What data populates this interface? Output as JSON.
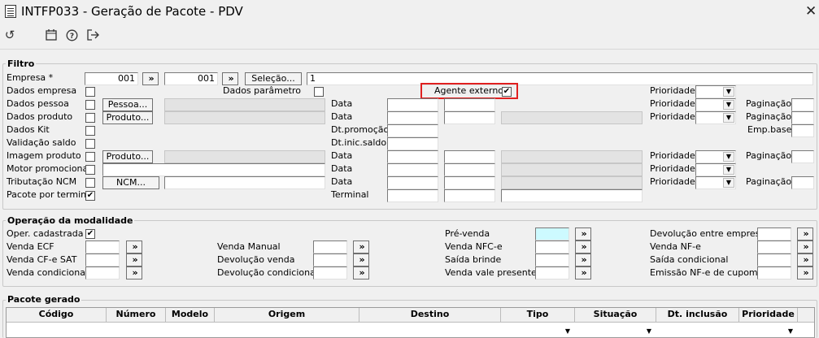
{
  "window": {
    "title": "INTFP033 - Geração de Pacote - PDV",
    "close": "✕"
  },
  "toolbar": {
    "refresh_icon": "↺",
    "calendar_icon": "calendar",
    "help_icon": "?",
    "exit_icon": "exit"
  },
  "filtro": {
    "title": "Filtro",
    "empresa_label": "Empresa *",
    "empresa_from": "001",
    "empresa_to": "001",
    "arrow": "»",
    "selecao_label": "Seleção...",
    "selecao_value": "1",
    "dados_empresa": "Dados empresa",
    "dados_parametro": "Dados parâmetro",
    "agente_externo": "Agente externo",
    "agente_checked": "✔",
    "dados_pessoa": "Dados pessoa",
    "pessoa_btn": "Pessoa...",
    "dados_produto": "Dados produto",
    "produto_btn": "Produto...",
    "dados_kit": "Dados Kit",
    "validacao_saldo": "Validação saldo",
    "imagem_produto": "Imagem produto",
    "motor_promocional": "Motor promocional",
    "tributacao_ncm": "Tributação NCM",
    "ncm_btn": "NCM...",
    "pacote_terminal": "Pacote por terminal",
    "pacote_terminal_checked": "✔",
    "data": "Data",
    "dt_promocao": "Dt.promoção",
    "dt_inic_saldo": "Dt.inic.saldo",
    "terminal": "Terminal",
    "prioridade": "Prioridade",
    "paginacao": "Paginação",
    "emp_base": "Emp.base"
  },
  "operacao": {
    "title": "Operação da modalidade",
    "oper_cadastrada": "Oper. cadastrada",
    "oper_checked": "✔",
    "arrow": "»",
    "venda_ecf": "Venda ECF",
    "venda_cfe_sat": "Venda CF-e SAT",
    "venda_condicional": "Venda condicional",
    "venda_manual": "Venda Manual",
    "devolucao_venda": "Devolução venda",
    "devolucao_condicional": "Devolução condicional",
    "pre_venda": "Pré-venda",
    "venda_nfce": "Venda NFC-e",
    "saida_brinde": "Saída brinde",
    "venda_vale_presente": "Venda vale presente",
    "devolucao_entre_empresa": "Devolução entre empresa",
    "venda_nfe": "Venda NF-e",
    "saida_condicional": "Saída condicional",
    "emissao_nfe_cupom": "Emissão NF-e de cupom"
  },
  "pacote": {
    "title": "Pacote gerado",
    "columns": [
      "Código",
      "Número",
      "Modelo",
      "Origem",
      "Destino",
      "Tipo",
      "Situação",
      "Dt. inclusão",
      "Prioridade"
    ]
  },
  "colors": {
    "background": "#f0f0f0",
    "highlight": "#e02020",
    "pre_venda_field": "#cdfaff"
  }
}
